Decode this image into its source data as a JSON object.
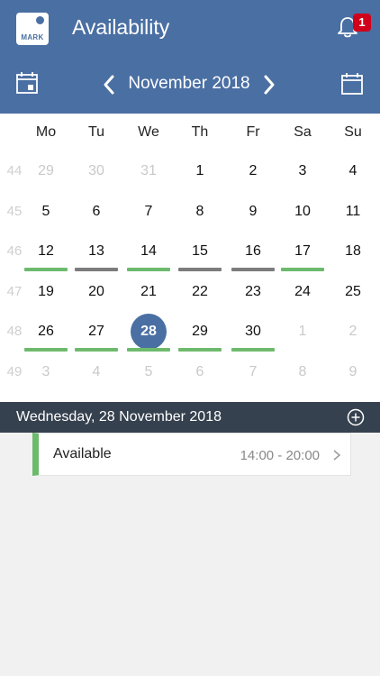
{
  "header": {
    "logo_text": "MARK",
    "title": "Availability",
    "notification_count": "1",
    "month_label": "November 2018",
    "icons": {
      "logo": "app-logo-icon",
      "bell": "bell-icon",
      "today": "calendar-today-icon",
      "prev": "chevron-left-icon",
      "next": "chevron-right-icon",
      "month_view": "calendar-icon"
    }
  },
  "calendar": {
    "weekdays": [
      "Mo",
      "Tu",
      "We",
      "Th",
      "Fr",
      "Sa",
      "Su"
    ],
    "weeks": [
      {
        "number": "44",
        "days": [
          {
            "label": "29",
            "current": false,
            "mark": "none"
          },
          {
            "label": "30",
            "current": false,
            "mark": "none"
          },
          {
            "label": "31",
            "current": false,
            "mark": "none"
          },
          {
            "label": "1",
            "current": true,
            "mark": "none"
          },
          {
            "label": "2",
            "current": true,
            "mark": "none"
          },
          {
            "label": "3",
            "current": true,
            "mark": "none"
          },
          {
            "label": "4",
            "current": true,
            "mark": "none"
          }
        ]
      },
      {
        "number": "45",
        "days": [
          {
            "label": "5",
            "current": true,
            "mark": "none"
          },
          {
            "label": "6",
            "current": true,
            "mark": "none"
          },
          {
            "label": "7",
            "current": true,
            "mark": "none"
          },
          {
            "label": "8",
            "current": true,
            "mark": "none"
          },
          {
            "label": "9",
            "current": true,
            "mark": "none"
          },
          {
            "label": "10",
            "current": true,
            "mark": "none"
          },
          {
            "label": "11",
            "current": true,
            "mark": "none"
          }
        ]
      },
      {
        "number": "46",
        "days": [
          {
            "label": "12",
            "current": true,
            "mark": "green"
          },
          {
            "label": "13",
            "current": true,
            "mark": "gray"
          },
          {
            "label": "14",
            "current": true,
            "mark": "green"
          },
          {
            "label": "15",
            "current": true,
            "mark": "gray"
          },
          {
            "label": "16",
            "current": true,
            "mark": "gray"
          },
          {
            "label": "17",
            "current": true,
            "mark": "green"
          },
          {
            "label": "18",
            "current": true,
            "mark": "none"
          }
        ]
      },
      {
        "number": "47",
        "days": [
          {
            "label": "19",
            "current": true,
            "mark": "none"
          },
          {
            "label": "20",
            "current": true,
            "mark": "none"
          },
          {
            "label": "21",
            "current": true,
            "mark": "none"
          },
          {
            "label": "22",
            "current": true,
            "mark": "none"
          },
          {
            "label": "23",
            "current": true,
            "mark": "none"
          },
          {
            "label": "24",
            "current": true,
            "mark": "none"
          },
          {
            "label": "25",
            "current": true,
            "mark": "none"
          }
        ]
      },
      {
        "number": "48",
        "days": [
          {
            "label": "26",
            "current": true,
            "mark": "green"
          },
          {
            "label": "27",
            "current": true,
            "mark": "green"
          },
          {
            "label": "28",
            "current": true,
            "mark": "green",
            "selected": true
          },
          {
            "label": "29",
            "current": true,
            "mark": "green"
          },
          {
            "label": "30",
            "current": true,
            "mark": "green"
          },
          {
            "label": "1",
            "current": false,
            "mark": "none"
          },
          {
            "label": "2",
            "current": false,
            "mark": "none"
          }
        ]
      },
      {
        "number": "49",
        "days": [
          {
            "label": "3",
            "current": false,
            "mark": "none"
          },
          {
            "label": "4",
            "current": false,
            "mark": "none"
          },
          {
            "label": "5",
            "current": false,
            "mark": "none"
          },
          {
            "label": "6",
            "current": false,
            "mark": "none"
          },
          {
            "label": "7",
            "current": false,
            "mark": "none"
          },
          {
            "label": "8",
            "current": false,
            "mark": "none"
          },
          {
            "label": "9",
            "current": false,
            "mark": "none"
          }
        ]
      }
    ],
    "colors": {
      "available": "#6dba6d",
      "unavailable": "#7c7c7c",
      "selected": "#4a6fa3"
    }
  },
  "day_detail": {
    "date_label": "Wednesday, 28 November 2018",
    "add_icon": "plus-circle-icon",
    "entries": [
      {
        "label": "Available",
        "time": "14:00 - 20:00",
        "status_color": "#6dba6d"
      }
    ]
  },
  "theme": {
    "header_bg": "#4a6fa3",
    "date_bar_bg": "#36414f",
    "badge_bg": "#d0021b"
  }
}
